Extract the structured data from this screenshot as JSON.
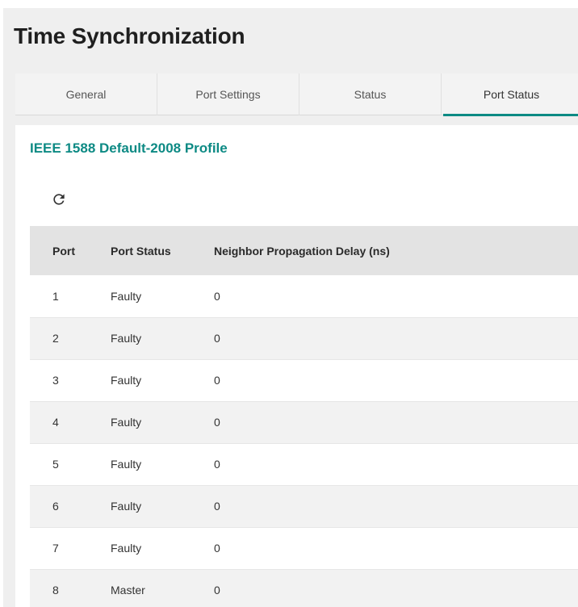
{
  "page": {
    "title": "Time Synchronization"
  },
  "tabs": [
    {
      "label": "General",
      "active": false
    },
    {
      "label": "Port Settings",
      "active": false
    },
    {
      "label": "Status",
      "active": false
    },
    {
      "label": "Port Status",
      "active": true
    }
  ],
  "profile": {
    "title": "IEEE 1588 Default-2008 Profile",
    "refresh_icon": "refresh-icon"
  },
  "table": {
    "headers": {
      "port": "Port",
      "port_status": "Port Status",
      "delay": "Neighbor Propagation Delay (ns)"
    },
    "rows": [
      {
        "port": "1",
        "status": "Faulty",
        "delay": "0"
      },
      {
        "port": "2",
        "status": "Faulty",
        "delay": "0"
      },
      {
        "port": "3",
        "status": "Faulty",
        "delay": "0"
      },
      {
        "port": "4",
        "status": "Faulty",
        "delay": "0"
      },
      {
        "port": "5",
        "status": "Faulty",
        "delay": "0"
      },
      {
        "port": "6",
        "status": "Faulty",
        "delay": "0"
      },
      {
        "port": "7",
        "status": "Faulty",
        "delay": "0"
      },
      {
        "port": "8",
        "status": "Master",
        "delay": "0"
      }
    ]
  },
  "colors": {
    "accent": "#0d8a84",
    "panel_bg": "#efefef",
    "header_bg": "#e3e3e3",
    "stripe_bg": "#f2f2f2"
  }
}
